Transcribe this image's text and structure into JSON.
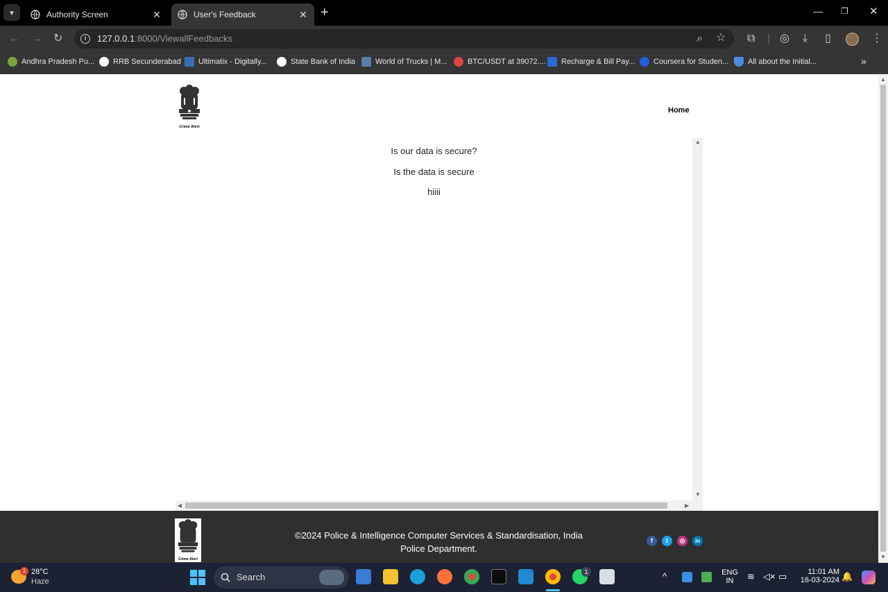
{
  "browser": {
    "tabs": [
      {
        "title": "Authority Screen"
      },
      {
        "title": "User's Feedback"
      }
    ],
    "url_host": "127.0.0.1",
    "url_rest": ":8000/ViewallFeedbacks",
    "bookmarks": [
      {
        "label": "Andhra Pradesh Pu...",
        "color": "#7aa33b"
      },
      {
        "label": "RRB Secunderabad",
        "color": "#ffffff"
      },
      {
        "label": "Ultimatix - Digitally...",
        "color": "#3a6fb5"
      },
      {
        "label": "State Bank of India",
        "color": "#ffffff"
      },
      {
        "label": "World of Trucks | M...",
        "color": "#5b7fa6"
      },
      {
        "label": "BTC/USDT at 39072....",
        "color": "#e04444"
      },
      {
        "label": "Recharge & Bill Pay...",
        "color": "#2d6bd4"
      },
      {
        "label": "Coursera for Studen...",
        "color": "#1f5fdb"
      },
      {
        "label": "All about the Initial...",
        "color": "#4a8be0"
      }
    ]
  },
  "site": {
    "logo_caption": "Crime Alert",
    "nav_home": "Home",
    "feedbacks": [
      "Is our data is secure?",
      "Is the data is secure",
      "hiiii"
    ],
    "footer_line1": "©2024 Police & Intelligence Computer Services & Standardisation, India",
    "footer_line2": "Police Department.",
    "social": [
      {
        "icon": "facebook-icon",
        "glyph": "f",
        "color": "#3b5998"
      },
      {
        "icon": "twitter-icon",
        "glyph": "t",
        "color": "#1da1f2"
      },
      {
        "icon": "instagram-icon",
        "glyph": "◎",
        "color": "#c13584"
      },
      {
        "icon": "linkedin-icon",
        "glyph": "in",
        "color": "#0077b5"
      }
    ]
  },
  "taskbar": {
    "weather_badge": "1",
    "weather_temp": "28°C",
    "weather_desc": "Haze",
    "search_label": "Search",
    "whatsapp_badge": "1",
    "lang1": "ENG",
    "lang2": "IN",
    "time": "11:01 AM",
    "date": "16-03-2024"
  }
}
